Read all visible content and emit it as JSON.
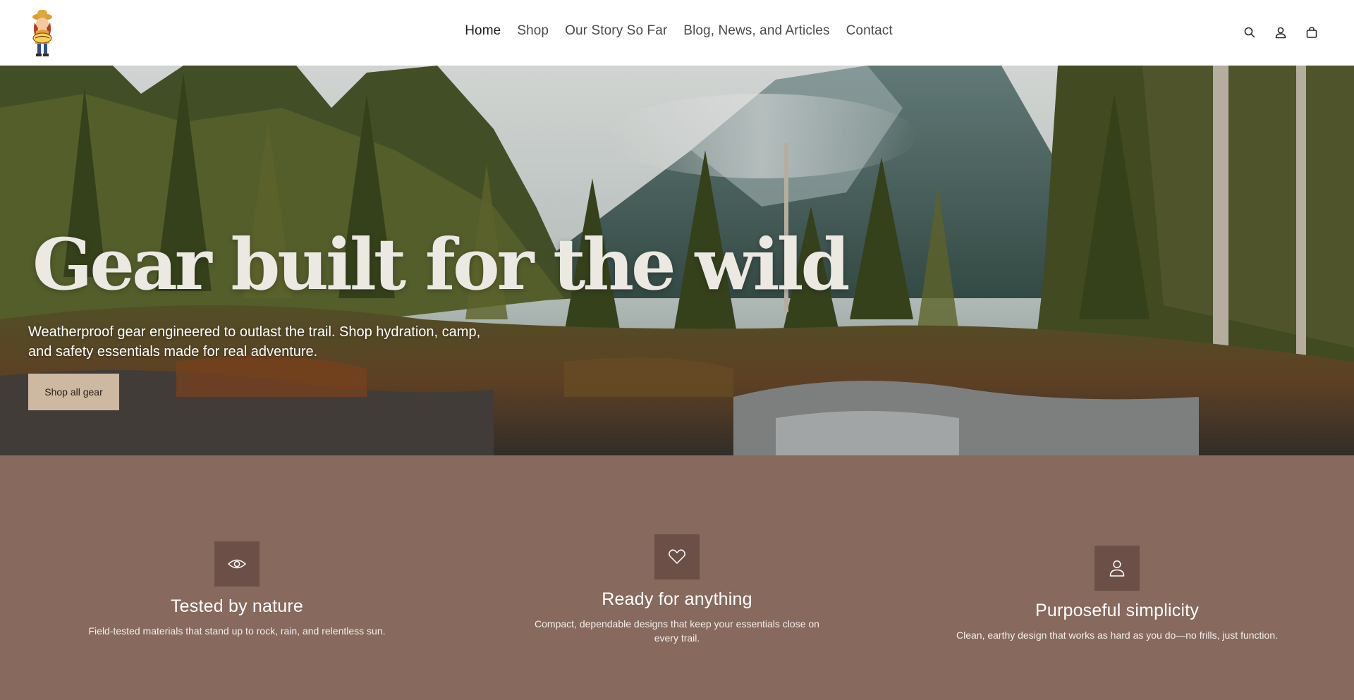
{
  "header": {
    "logo_name": "brand-logo",
    "nav": [
      {
        "label": "Home",
        "active": true
      },
      {
        "label": "Shop",
        "active": false
      },
      {
        "label": "Our Story So Far",
        "active": false
      },
      {
        "label": "Blog, News, and Articles",
        "active": false
      },
      {
        "label": "Contact",
        "active": false
      }
    ],
    "icons": [
      "search-icon",
      "account-icon",
      "cart-icon"
    ]
  },
  "hero": {
    "title": "Gear built for the wild",
    "subtitle": "Weatherproof gear engineered to outlast the trail. Shop hydration, camp, and safety essentials made for real adventure.",
    "button_label": "Shop all gear"
  },
  "features": {
    "background": "#87695d",
    "icon_box_color": "#6c5048",
    "items": [
      {
        "icon": "eye-icon",
        "title": "Tested by nature",
        "text": "Field-tested materials that stand up to rock, rain, and relentless sun."
      },
      {
        "icon": "heart-icon",
        "title": "Ready for anything",
        "text": "Compact, dependable designs that keep your essentials close on every trail."
      },
      {
        "icon": "person-icon",
        "title": "Purposeful simplicity",
        "text": "Clean, earthy design that works as hard as you do—no frills, just function."
      }
    ]
  },
  "colors": {
    "button_bg": "#cdb8a2",
    "title_color": "#ece8e2"
  }
}
